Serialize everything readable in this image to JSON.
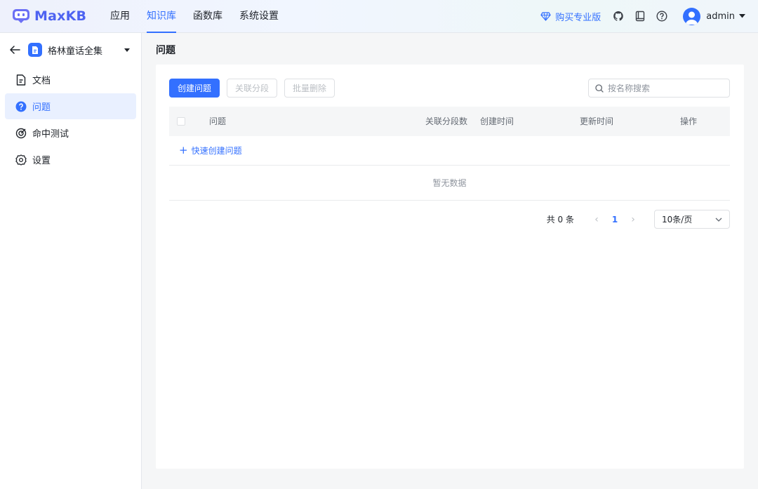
{
  "header": {
    "logo_text": "MaxKB",
    "nav": [
      {
        "label": "应用",
        "active": false
      },
      {
        "label": "知识库",
        "active": true
      },
      {
        "label": "函数库",
        "active": false
      },
      {
        "label": "系统设置",
        "active": false
      }
    ],
    "pro_label": "购买专业版",
    "user_name": "admin",
    "accent": "#3370ff"
  },
  "sidebar": {
    "kb_name": "格林童话全集",
    "items": [
      {
        "label": "文档",
        "icon": "document-icon",
        "active": false
      },
      {
        "label": "问题",
        "icon": "question-icon",
        "active": true
      },
      {
        "label": "命中测试",
        "icon": "target-icon",
        "active": false
      },
      {
        "label": "设置",
        "icon": "gear-icon",
        "active": false
      }
    ]
  },
  "main": {
    "title": "问题",
    "toolbar": {
      "create_label": "创建问题",
      "link_label": "关联分段",
      "delete_label": "批量删除"
    },
    "search": {
      "placeholder": "按名称搜索"
    },
    "table": {
      "columns": [
        "问题",
        "关联分段数",
        "创建时间",
        "更新时间",
        "操作"
      ],
      "quick_create": "快速创建问题",
      "empty_text": "暂无数据"
    },
    "pagination": {
      "total_text": "共 0 条",
      "current_page": "1",
      "page_size": "10条/页"
    }
  }
}
